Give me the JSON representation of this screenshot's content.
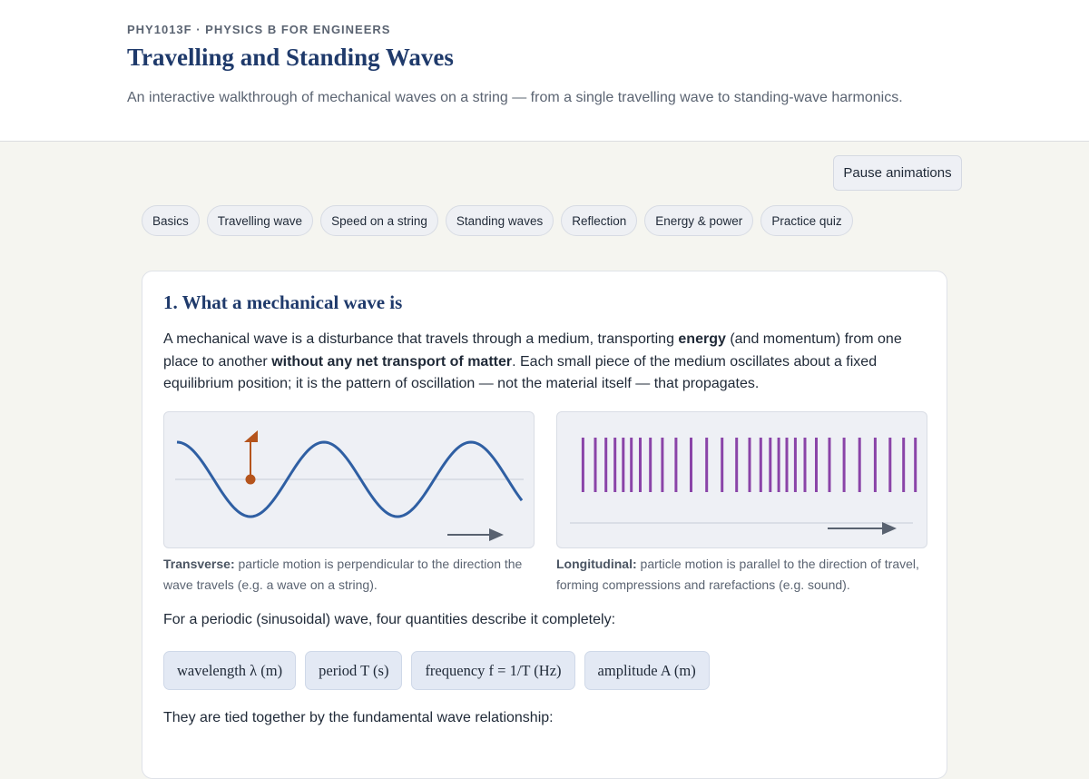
{
  "header": {
    "course": "PHY1013F · PHYSICS B FOR ENGINEERS",
    "title": "Travelling and Standing Waves",
    "subtitle": "An interactive walkthrough of mechanical waves on a string — from a single travelling wave to standing-wave harmonics."
  },
  "controls": {
    "pause_label": "Pause animations"
  },
  "tabs": [
    {
      "label": "Basics"
    },
    {
      "label": "Travelling wave"
    },
    {
      "label": "Speed on a string"
    },
    {
      "label": "Standing waves"
    },
    {
      "label": "Reflection"
    },
    {
      "label": "Energy & power"
    },
    {
      "label": "Practice quiz"
    }
  ],
  "section": {
    "title": "1. What a mechanical wave is",
    "intro": {
      "p1": "A mechanical wave is a disturbance that travels through a medium, transporting ",
      "b1": "energy",
      "p2": " (and momentum) from one place to another ",
      "b2": "without any net transport of matter",
      "p3": ". Each small piece of the medium oscillates about a fixed equilibrium position; it is the pattern of oscillation — not the material itself — that propagates."
    },
    "transverse": {
      "label": "Transverse:",
      "text": " particle motion is perpendicular to the direction the wave travels (e.g. a wave on a string)."
    },
    "longitudinal": {
      "label": "Longitudinal:",
      "text": " particle motion is parallel to the direction of travel, forming compressions and rarefactions (e.g. sound)."
    },
    "periodic_text": "For a periodic (sinusoidal) wave, four quantities describe it completely:",
    "quantities": [
      {
        "label": "wavelength λ (m)"
      },
      {
        "label": "period T (s)"
      },
      {
        "label": "frequency f = 1/T (Hz)"
      },
      {
        "label": "amplitude A (m)"
      }
    ],
    "tied_text": "They are tied together by the fundamental wave relationship:"
  },
  "colors": {
    "accent": "#1f3a6b",
    "wave": "#2f5fa3",
    "marker": "#b5541c",
    "compression": "#8a44a8",
    "arrow": "#596270"
  }
}
